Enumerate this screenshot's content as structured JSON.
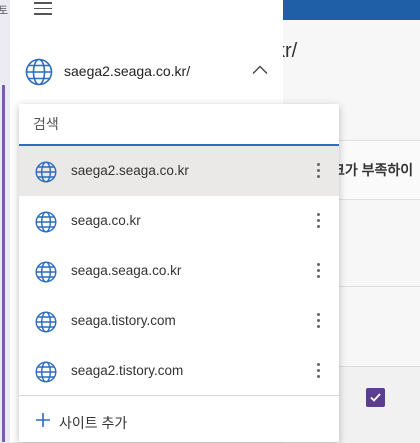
{
  "header": {
    "current_site": "saega2.seaga.co.kr/"
  },
  "background": {
    "domain_fragment": "kr/",
    "message_fragment": "크가 부족하이",
    "strip_glyph": "토"
  },
  "dropdown": {
    "search_placeholder": "검색",
    "items": [
      {
        "label": "saega2.seaga.co.kr",
        "selected": true
      },
      {
        "label": "seaga.co.kr",
        "selected": false
      },
      {
        "label": "seaga.seaga.co.kr",
        "selected": false
      },
      {
        "label": "seaga.tistory.com",
        "selected": false
      },
      {
        "label": "seaga2.tistory.com",
        "selected": false
      }
    ],
    "add_site_label": "사이트 추가"
  },
  "colors": {
    "accent": "#2d6cc0",
    "brand_bar": "#1e5fa8",
    "checkbox": "#5b3f8e"
  }
}
